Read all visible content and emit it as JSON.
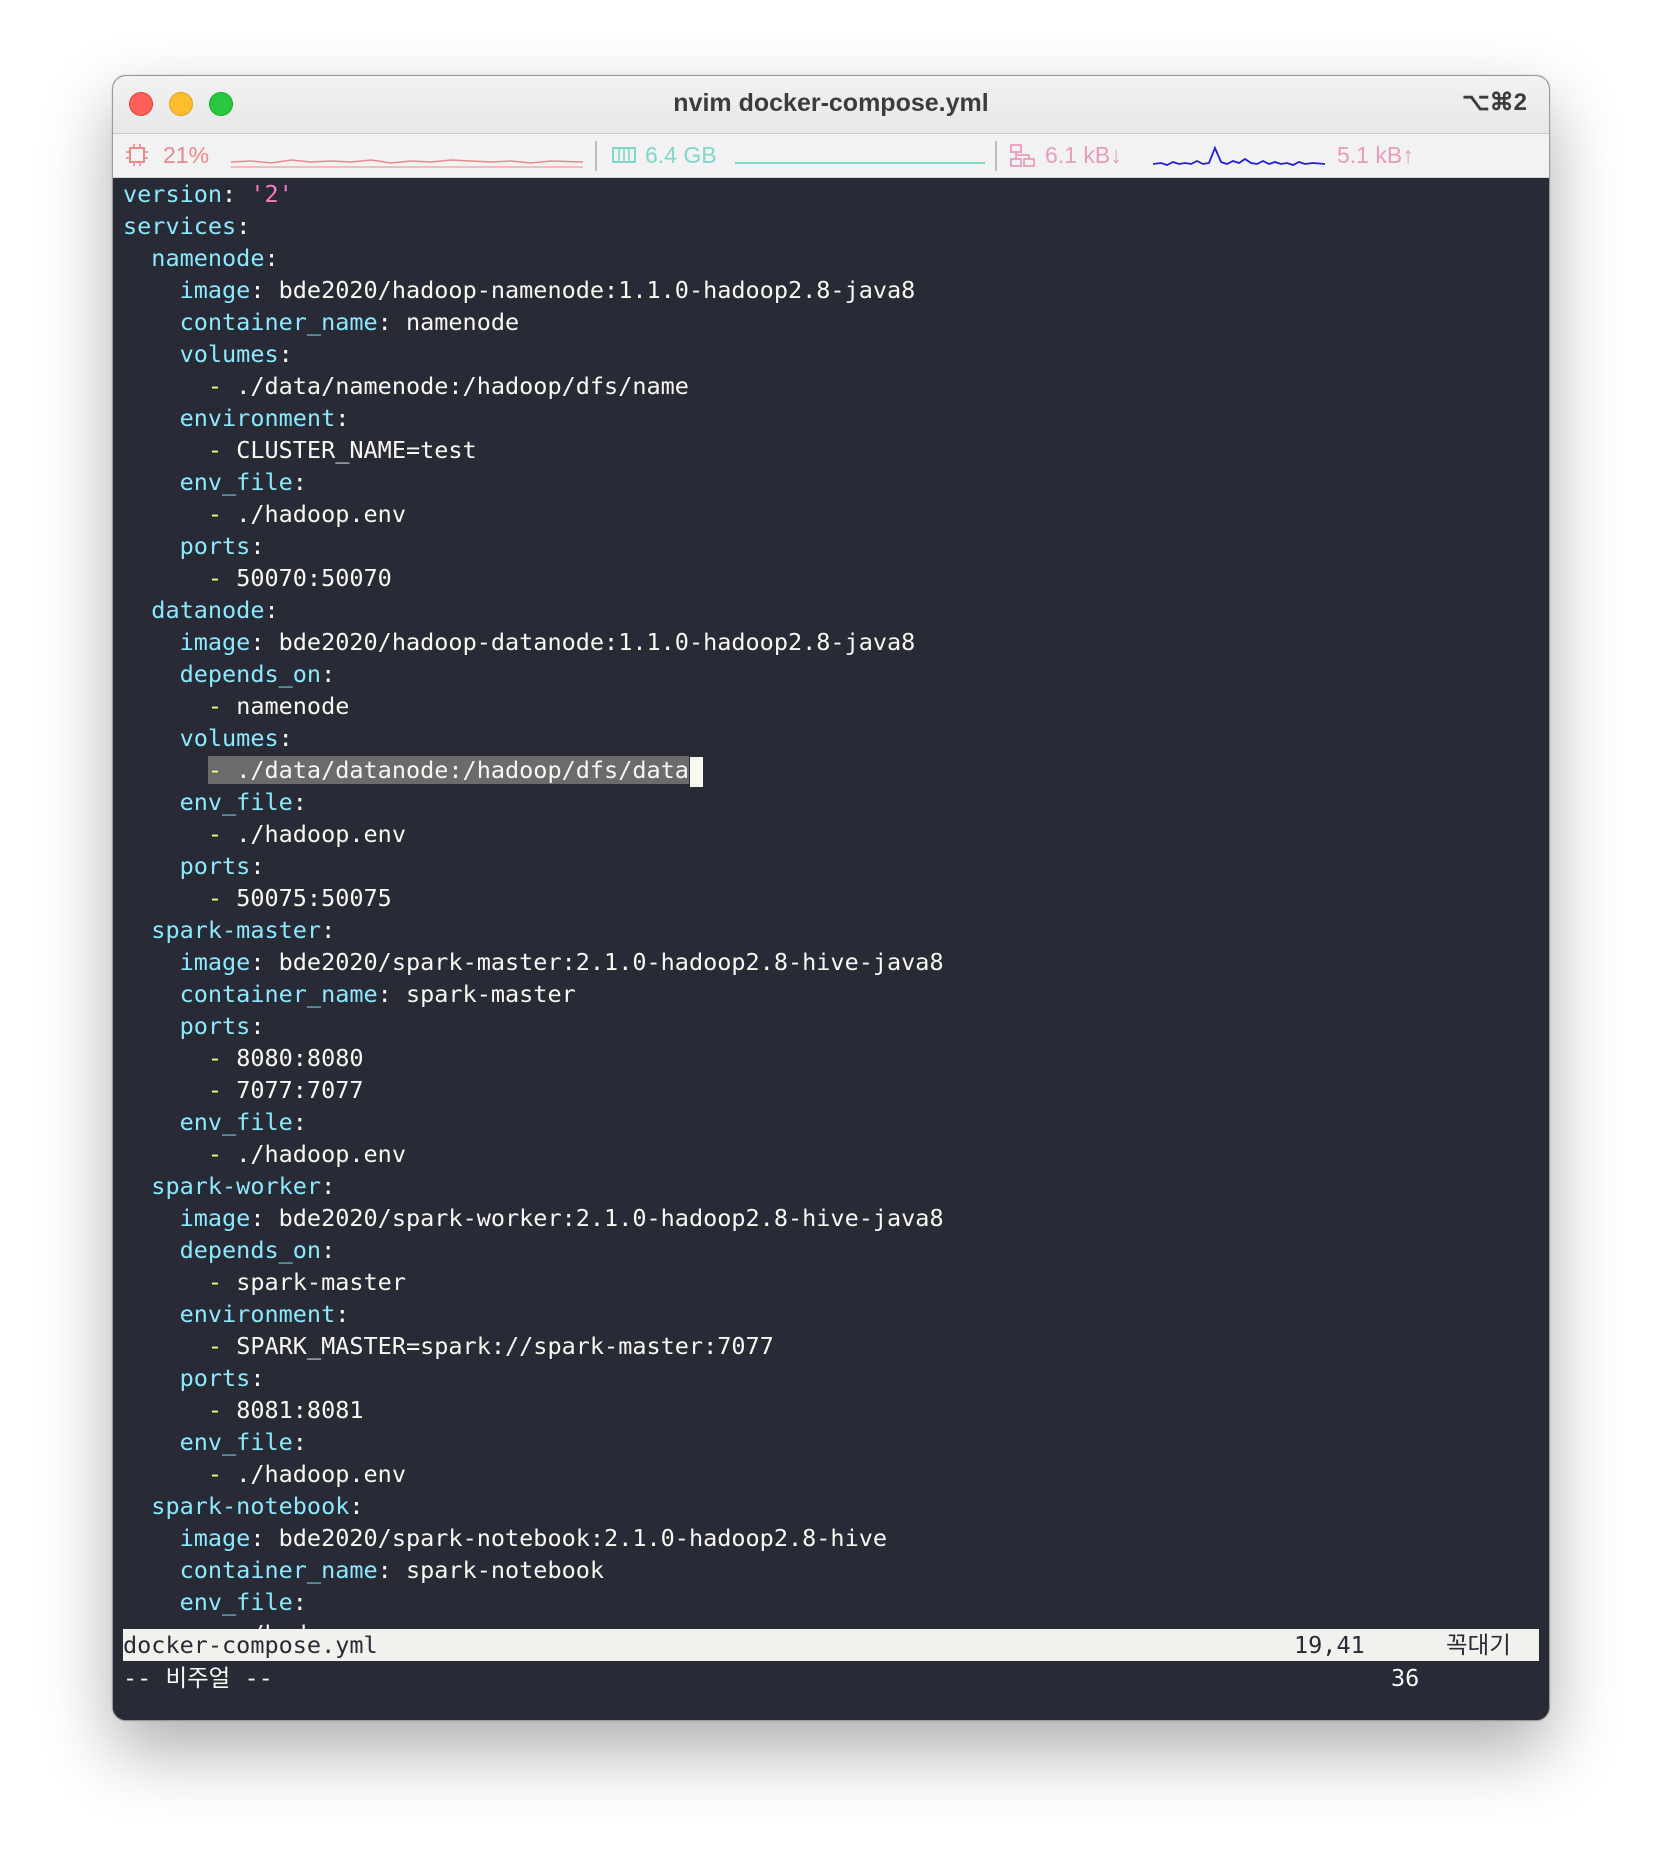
{
  "window": {
    "title": "nvim docker-compose.yml",
    "shortcut": "⌥⌘2"
  },
  "statusbar": {
    "cpu_icon": "cpu-icon",
    "cpu": "21%",
    "mem_icon": "memory-icon",
    "memory": "6.4 GB",
    "net_icon": "network-icon",
    "download": "6.1 kB↓",
    "upload": "5.1 kB↑"
  },
  "colors": {
    "background": "#282a36",
    "key": "#8be9fd",
    "string": "#ff79c6",
    "dash": "#f1fa8c",
    "text": "#f8f8f2",
    "selection": "#6b6b6b"
  },
  "editor": {
    "lines": [
      {
        "indent": "",
        "dash": "",
        "key": "version",
        "colon": ": ",
        "str": "'2'",
        "value": ""
      },
      {
        "indent": "",
        "dash": "",
        "key": "services",
        "colon": ":",
        "str": "",
        "value": ""
      },
      {
        "indent": "  ",
        "dash": "",
        "key": "namenode",
        "colon": ":",
        "str": "",
        "value": ""
      },
      {
        "indent": "    ",
        "dash": "",
        "key": "image",
        "colon": ": ",
        "str": "",
        "value": "bde2020/hadoop-namenode:1.1.0-hadoop2.8-java8"
      },
      {
        "indent": "    ",
        "dash": "",
        "key": "container_name",
        "colon": ": ",
        "str": "",
        "value": "namenode"
      },
      {
        "indent": "    ",
        "dash": "",
        "key": "volumes",
        "colon": ":",
        "str": "",
        "value": ""
      },
      {
        "indent": "      ",
        "dash": "- ",
        "key": "",
        "colon": "",
        "str": "",
        "value": "./data/namenode:/hadoop/dfs/name"
      },
      {
        "indent": "    ",
        "dash": "",
        "key": "environment",
        "colon": ":",
        "str": "",
        "value": ""
      },
      {
        "indent": "      ",
        "dash": "- ",
        "key": "",
        "colon": "",
        "str": "",
        "value": "CLUSTER_NAME=test"
      },
      {
        "indent": "    ",
        "dash": "",
        "key": "env_file",
        "colon": ":",
        "str": "",
        "value": ""
      },
      {
        "indent": "      ",
        "dash": "- ",
        "key": "",
        "colon": "",
        "str": "",
        "value": "./hadoop.env"
      },
      {
        "indent": "    ",
        "dash": "",
        "key": "ports",
        "colon": ":",
        "str": "",
        "value": ""
      },
      {
        "indent": "      ",
        "dash": "- ",
        "key": "",
        "colon": "",
        "str": "",
        "value": "50070:50070"
      },
      {
        "indent": "  ",
        "dash": "",
        "key": "datanode",
        "colon": ":",
        "str": "",
        "value": ""
      },
      {
        "indent": "    ",
        "dash": "",
        "key": "image",
        "colon": ": ",
        "str": "",
        "value": "bde2020/hadoop-datanode:1.1.0-hadoop2.8-java8"
      },
      {
        "indent": "    ",
        "dash": "",
        "key": "depends_on",
        "colon": ":",
        "str": "",
        "value": ""
      },
      {
        "indent": "      ",
        "dash": "- ",
        "key": "",
        "colon": "",
        "str": "",
        "value": "namenode"
      },
      {
        "indent": "    ",
        "dash": "",
        "key": "volumes",
        "colon": ":",
        "str": "",
        "value": ""
      },
      {
        "indent": "      ",
        "dash": "- ",
        "key": "",
        "colon": "",
        "str": "",
        "value": "./data/datanode:/hadoop/dfs/data",
        "selected": true
      },
      {
        "indent": "    ",
        "dash": "",
        "key": "env_file",
        "colon": ":",
        "str": "",
        "value": ""
      },
      {
        "indent": "      ",
        "dash": "- ",
        "key": "",
        "colon": "",
        "str": "",
        "value": "./hadoop.env"
      },
      {
        "indent": "    ",
        "dash": "",
        "key": "ports",
        "colon": ":",
        "str": "",
        "value": ""
      },
      {
        "indent": "      ",
        "dash": "- ",
        "key": "",
        "colon": "",
        "str": "",
        "value": "50075:50075"
      },
      {
        "indent": "  ",
        "dash": "",
        "key": "spark-master",
        "colon": ":",
        "str": "",
        "value": ""
      },
      {
        "indent": "    ",
        "dash": "",
        "key": "image",
        "colon": ": ",
        "str": "",
        "value": "bde2020/spark-master:2.1.0-hadoop2.8-hive-java8"
      },
      {
        "indent": "    ",
        "dash": "",
        "key": "container_name",
        "colon": ": ",
        "str": "",
        "value": "spark-master"
      },
      {
        "indent": "    ",
        "dash": "",
        "key": "ports",
        "colon": ":",
        "str": "",
        "value": ""
      },
      {
        "indent": "      ",
        "dash": "- ",
        "key": "",
        "colon": "",
        "str": "",
        "value": "8080:8080"
      },
      {
        "indent": "      ",
        "dash": "- ",
        "key": "",
        "colon": "",
        "str": "",
        "value": "7077:7077"
      },
      {
        "indent": "    ",
        "dash": "",
        "key": "env_file",
        "colon": ":",
        "str": "",
        "value": ""
      },
      {
        "indent": "      ",
        "dash": "- ",
        "key": "",
        "colon": "",
        "str": "",
        "value": "./hadoop.env"
      },
      {
        "indent": "  ",
        "dash": "",
        "key": "spark-worker",
        "colon": ":",
        "str": "",
        "value": ""
      },
      {
        "indent": "    ",
        "dash": "",
        "key": "image",
        "colon": ": ",
        "str": "",
        "value": "bde2020/spark-worker:2.1.0-hadoop2.8-hive-java8"
      },
      {
        "indent": "    ",
        "dash": "",
        "key": "depends_on",
        "colon": ":",
        "str": "",
        "value": ""
      },
      {
        "indent": "      ",
        "dash": "- ",
        "key": "",
        "colon": "",
        "str": "",
        "value": "spark-master"
      },
      {
        "indent": "    ",
        "dash": "",
        "key": "environment",
        "colon": ":",
        "str": "",
        "value": ""
      },
      {
        "indent": "      ",
        "dash": "- ",
        "key": "",
        "colon": "",
        "str": "",
        "value": "SPARK_MASTER=spark://spark-master:7077"
      },
      {
        "indent": "    ",
        "dash": "",
        "key": "ports",
        "colon": ":",
        "str": "",
        "value": ""
      },
      {
        "indent": "      ",
        "dash": "- ",
        "key": "",
        "colon": "",
        "str": "",
        "value": "8081:8081"
      },
      {
        "indent": "    ",
        "dash": "",
        "key": "env_file",
        "colon": ":",
        "str": "",
        "value": ""
      },
      {
        "indent": "      ",
        "dash": "- ",
        "key": "",
        "colon": "",
        "str": "",
        "value": "./hadoop.env"
      },
      {
        "indent": "  ",
        "dash": "",
        "key": "spark-notebook",
        "colon": ":",
        "str": "",
        "value": ""
      },
      {
        "indent": "    ",
        "dash": "",
        "key": "image",
        "colon": ": ",
        "str": "",
        "value": "bde2020/spark-notebook:2.1.0-hadoop2.8-hive"
      },
      {
        "indent": "    ",
        "dash": "",
        "key": "container_name",
        "colon": ": ",
        "str": "",
        "value": "spark-notebook"
      },
      {
        "indent": "    ",
        "dash": "",
        "key": "env_file",
        "colon": ":",
        "str": "",
        "value": ""
      },
      {
        "indent": "      ",
        "dash": "- ",
        "key": "",
        "colon": "",
        "str": "",
        "value": "./hadoop.env"
      }
    ]
  },
  "statusline": {
    "filename": "docker-compose.yml",
    "position": "19,41",
    "mode": "꼭대기"
  },
  "cmdline": {
    "mode": "-- 비주얼 --",
    "count": "36"
  }
}
